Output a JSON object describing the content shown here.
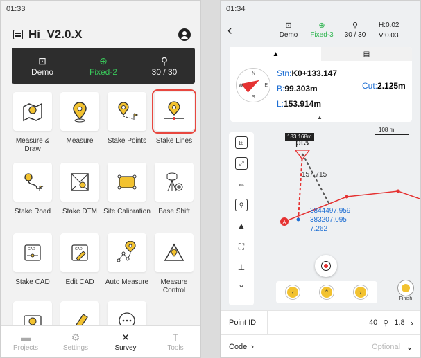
{
  "left": {
    "time": "01:33",
    "project_name": "Hi_V2.0.X",
    "status": [
      {
        "label": "Demo",
        "icon": "device-icon"
      },
      {
        "label": "Fixed-2",
        "icon": "gnss-fix-icon",
        "color": "#39c85a"
      },
      {
        "label": "30 / 30",
        "icon": "satellite-icon"
      }
    ],
    "functions": [
      {
        "label": "Measure & Draw",
        "icon": "map-pin-icon"
      },
      {
        "label": "Measure",
        "icon": "pin-icon"
      },
      {
        "label": "Stake Points",
        "icon": "stake-points-icon"
      },
      {
        "label": "Stake Lines",
        "icon": "stake-lines-icon",
        "selected": true
      },
      {
        "label": "Stake Road",
        "icon": "stake-road-icon"
      },
      {
        "label": "Stake DTM",
        "icon": "dtm-icon"
      },
      {
        "label": "Site Calibration",
        "icon": "calibration-icon"
      },
      {
        "label": "Base Shift",
        "icon": "base-shift-icon"
      },
      {
        "label": "Stake CAD",
        "icon": "stake-cad-icon"
      },
      {
        "label": "Edit CAD",
        "icon": "edit-cad-icon"
      },
      {
        "label": "Auto Measure",
        "icon": "auto-measure-icon"
      },
      {
        "label": "Measure Control",
        "icon": "measure-control-icon"
      }
    ],
    "nav": [
      {
        "label": "Projects",
        "icon": "folder-icon"
      },
      {
        "label": "Settings",
        "icon": "gear-icon"
      },
      {
        "label": "Survey",
        "icon": "survey-icon",
        "active": true
      },
      {
        "label": "Tools",
        "icon": "tools-icon"
      }
    ]
  },
  "right": {
    "time": "01:34",
    "status": [
      {
        "label": "Demo",
        "icon": "device-icon"
      },
      {
        "label": "Fixed-3",
        "icon": "gnss-fix-icon",
        "color": "#2fb550"
      },
      {
        "label": "30 / 30",
        "icon": "satellite-icon"
      }
    ],
    "h_precision": "H:0.02",
    "v_precision": "V:0.03",
    "stn_label": "Stn:",
    "stn_value": "K0+133.147",
    "b_label": "B:",
    "b_value": "99.303m",
    "l_label": "L:",
    "l_value": "153.914m",
    "cut_label": "Cut:",
    "cut_value": "2.125m",
    "scale": "108 m",
    "dist_label": "183.168m",
    "point_name": "pt3",
    "offset_value": "157.715",
    "coord_n": "3844497.959",
    "coord_e": "383207.095",
    "coord_h": "7.262",
    "start_marker": "A",
    "finish_label": "Finish",
    "point_id_label": "Point ID",
    "point_id_value": "40",
    "rod_height": "1.8",
    "code_label": "Code",
    "code_placeholder": "Optional"
  }
}
